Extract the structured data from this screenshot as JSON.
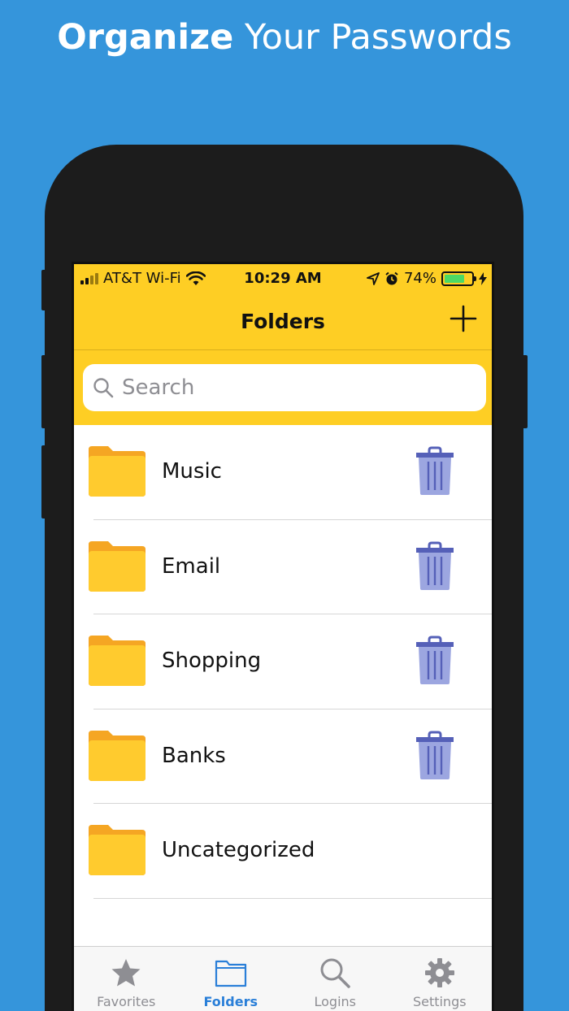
{
  "headline": {
    "strong": "Organize",
    "light": "Your Passwords"
  },
  "status_bar": {
    "carrier": "AT&T Wi-Fi",
    "time": "10:29 AM",
    "battery": "74%",
    "battery_level": 0.74
  },
  "nav": {
    "title": "Folders"
  },
  "search": {
    "placeholder": "Search"
  },
  "folders": [
    {
      "label": "Music",
      "deletable": true
    },
    {
      "label": "Email",
      "deletable": true
    },
    {
      "label": "Shopping",
      "deletable": true
    },
    {
      "label": "Banks",
      "deletable": true
    },
    {
      "label": "Uncategorized",
      "deletable": false
    }
  ],
  "tabs": [
    {
      "label": "Favorites",
      "icon": "star-icon",
      "active": false
    },
    {
      "label": "Folders",
      "icon": "folder-icon",
      "active": true
    },
    {
      "label": "Logins",
      "icon": "search-icon",
      "active": false
    },
    {
      "label": "Settings",
      "icon": "gear-icon",
      "active": false
    }
  ],
  "colors": {
    "background": "#3595DB",
    "accent_yellow": "#FECE24",
    "folder_yellow": "#FFCB2E",
    "trash": "#9CA6E0",
    "tab_active": "#2A7FD8"
  }
}
